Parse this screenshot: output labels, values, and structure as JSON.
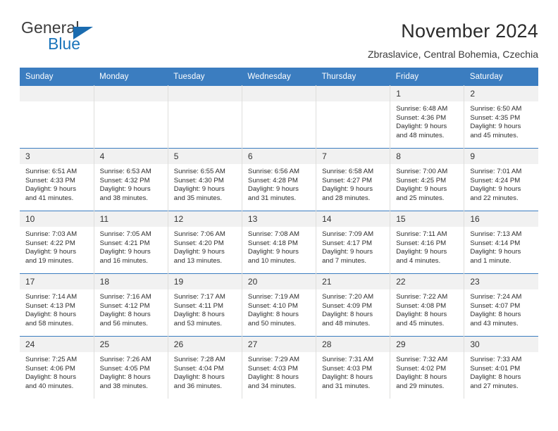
{
  "brand": {
    "name_top": "General",
    "name_bottom": "Blue",
    "accent_color": "#1b75bb"
  },
  "header": {
    "title": "November 2024",
    "subtitle": "Zbraslavice, Central Bohemia, Czechia"
  },
  "theme": {
    "header_band": "#3b7dc0",
    "daynum_band": "#f1f1f1",
    "grid_line": "#dededc"
  },
  "weekdays": [
    "Sunday",
    "Monday",
    "Tuesday",
    "Wednesday",
    "Thursday",
    "Friday",
    "Saturday"
  ],
  "weeks": [
    [
      {
        "day": "",
        "lines": []
      },
      {
        "day": "",
        "lines": []
      },
      {
        "day": "",
        "lines": []
      },
      {
        "day": "",
        "lines": []
      },
      {
        "day": "",
        "lines": []
      },
      {
        "day": "1",
        "lines": [
          "Sunrise: 6:48 AM",
          "Sunset: 4:36 PM",
          "Daylight: 9 hours",
          "and 48 minutes."
        ]
      },
      {
        "day": "2",
        "lines": [
          "Sunrise: 6:50 AM",
          "Sunset: 4:35 PM",
          "Daylight: 9 hours",
          "and 45 minutes."
        ]
      }
    ],
    [
      {
        "day": "3",
        "lines": [
          "Sunrise: 6:51 AM",
          "Sunset: 4:33 PM",
          "Daylight: 9 hours",
          "and 41 minutes."
        ]
      },
      {
        "day": "4",
        "lines": [
          "Sunrise: 6:53 AM",
          "Sunset: 4:32 PM",
          "Daylight: 9 hours",
          "and 38 minutes."
        ]
      },
      {
        "day": "5",
        "lines": [
          "Sunrise: 6:55 AM",
          "Sunset: 4:30 PM",
          "Daylight: 9 hours",
          "and 35 minutes."
        ]
      },
      {
        "day": "6",
        "lines": [
          "Sunrise: 6:56 AM",
          "Sunset: 4:28 PM",
          "Daylight: 9 hours",
          "and 31 minutes."
        ]
      },
      {
        "day": "7",
        "lines": [
          "Sunrise: 6:58 AM",
          "Sunset: 4:27 PM",
          "Daylight: 9 hours",
          "and 28 minutes."
        ]
      },
      {
        "day": "8",
        "lines": [
          "Sunrise: 7:00 AM",
          "Sunset: 4:25 PM",
          "Daylight: 9 hours",
          "and 25 minutes."
        ]
      },
      {
        "day": "9",
        "lines": [
          "Sunrise: 7:01 AM",
          "Sunset: 4:24 PM",
          "Daylight: 9 hours",
          "and 22 minutes."
        ]
      }
    ],
    [
      {
        "day": "10",
        "lines": [
          "Sunrise: 7:03 AM",
          "Sunset: 4:22 PM",
          "Daylight: 9 hours",
          "and 19 minutes."
        ]
      },
      {
        "day": "11",
        "lines": [
          "Sunrise: 7:05 AM",
          "Sunset: 4:21 PM",
          "Daylight: 9 hours",
          "and 16 minutes."
        ]
      },
      {
        "day": "12",
        "lines": [
          "Sunrise: 7:06 AM",
          "Sunset: 4:20 PM",
          "Daylight: 9 hours",
          "and 13 minutes."
        ]
      },
      {
        "day": "13",
        "lines": [
          "Sunrise: 7:08 AM",
          "Sunset: 4:18 PM",
          "Daylight: 9 hours",
          "and 10 minutes."
        ]
      },
      {
        "day": "14",
        "lines": [
          "Sunrise: 7:09 AM",
          "Sunset: 4:17 PM",
          "Daylight: 9 hours",
          "and 7 minutes."
        ]
      },
      {
        "day": "15",
        "lines": [
          "Sunrise: 7:11 AM",
          "Sunset: 4:16 PM",
          "Daylight: 9 hours",
          "and 4 minutes."
        ]
      },
      {
        "day": "16",
        "lines": [
          "Sunrise: 7:13 AM",
          "Sunset: 4:14 PM",
          "Daylight: 9 hours",
          "and 1 minute."
        ]
      }
    ],
    [
      {
        "day": "17",
        "lines": [
          "Sunrise: 7:14 AM",
          "Sunset: 4:13 PM",
          "Daylight: 8 hours",
          "and 58 minutes."
        ]
      },
      {
        "day": "18",
        "lines": [
          "Sunrise: 7:16 AM",
          "Sunset: 4:12 PM",
          "Daylight: 8 hours",
          "and 56 minutes."
        ]
      },
      {
        "day": "19",
        "lines": [
          "Sunrise: 7:17 AM",
          "Sunset: 4:11 PM",
          "Daylight: 8 hours",
          "and 53 minutes."
        ]
      },
      {
        "day": "20",
        "lines": [
          "Sunrise: 7:19 AM",
          "Sunset: 4:10 PM",
          "Daylight: 8 hours",
          "and 50 minutes."
        ]
      },
      {
        "day": "21",
        "lines": [
          "Sunrise: 7:20 AM",
          "Sunset: 4:09 PM",
          "Daylight: 8 hours",
          "and 48 minutes."
        ]
      },
      {
        "day": "22",
        "lines": [
          "Sunrise: 7:22 AM",
          "Sunset: 4:08 PM",
          "Daylight: 8 hours",
          "and 45 minutes."
        ]
      },
      {
        "day": "23",
        "lines": [
          "Sunrise: 7:24 AM",
          "Sunset: 4:07 PM",
          "Daylight: 8 hours",
          "and 43 minutes."
        ]
      }
    ],
    [
      {
        "day": "24",
        "lines": [
          "Sunrise: 7:25 AM",
          "Sunset: 4:06 PM",
          "Daylight: 8 hours",
          "and 40 minutes."
        ]
      },
      {
        "day": "25",
        "lines": [
          "Sunrise: 7:26 AM",
          "Sunset: 4:05 PM",
          "Daylight: 8 hours",
          "and 38 minutes."
        ]
      },
      {
        "day": "26",
        "lines": [
          "Sunrise: 7:28 AM",
          "Sunset: 4:04 PM",
          "Daylight: 8 hours",
          "and 36 minutes."
        ]
      },
      {
        "day": "27",
        "lines": [
          "Sunrise: 7:29 AM",
          "Sunset: 4:03 PM",
          "Daylight: 8 hours",
          "and 34 minutes."
        ]
      },
      {
        "day": "28",
        "lines": [
          "Sunrise: 7:31 AM",
          "Sunset: 4:03 PM",
          "Daylight: 8 hours",
          "and 31 minutes."
        ]
      },
      {
        "day": "29",
        "lines": [
          "Sunrise: 7:32 AM",
          "Sunset: 4:02 PM",
          "Daylight: 8 hours",
          "and 29 minutes."
        ]
      },
      {
        "day": "30",
        "lines": [
          "Sunrise: 7:33 AM",
          "Sunset: 4:01 PM",
          "Daylight: 8 hours",
          "and 27 minutes."
        ]
      }
    ]
  ]
}
